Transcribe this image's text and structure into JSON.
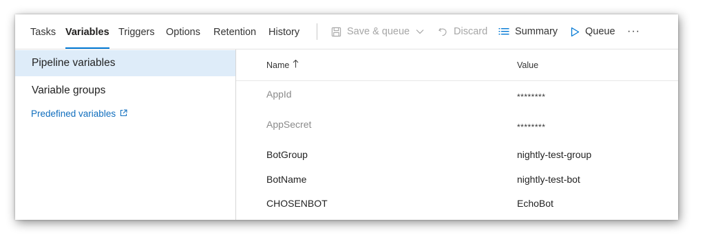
{
  "tabs": [
    {
      "label": "Tasks",
      "active": false
    },
    {
      "label": "Variables",
      "active": true
    },
    {
      "label": "Triggers",
      "active": false
    },
    {
      "label": "Options",
      "active": false
    },
    {
      "label": "Retention",
      "active": false
    },
    {
      "label": "History",
      "active": false
    }
  ],
  "commands": {
    "save_queue": {
      "label": "Save & queue",
      "icon": "save-icon",
      "disabled": true
    },
    "discard": {
      "label": "Discard",
      "icon": "undo-icon",
      "disabled": true
    },
    "summary": {
      "label": "Summary",
      "icon": "list-icon"
    },
    "queue": {
      "label": "Queue",
      "icon": "play-icon"
    },
    "more": {
      "label": "···",
      "icon": "more-icon"
    }
  },
  "sidebar": {
    "items": [
      {
        "label": "Pipeline variables",
        "selected": true
      },
      {
        "label": "Variable groups",
        "selected": false
      }
    ],
    "link": {
      "label": "Predefined variables",
      "icon": "external-link-icon"
    }
  },
  "table": {
    "headers": {
      "name": "Name",
      "value": "Value",
      "sort_icon": "sort-ascending-icon"
    },
    "rows": [
      {
        "name": "AppId",
        "value": "********",
        "secret": true
      },
      {
        "name": "AppSecret",
        "value": "********",
        "secret": true
      },
      {
        "name": "BotGroup",
        "value": "nightly-test-group",
        "secret": false
      },
      {
        "name": "BotName",
        "value": "nightly-test-bot",
        "secret": false
      },
      {
        "name": "CHOSENBOT",
        "value": "EchoBot",
        "secret": false
      }
    ]
  },
  "colors": {
    "accent": "#0078d4",
    "selected_bg": "#deecf9",
    "link": "#106ebe",
    "disabled": "#a6a6a6"
  }
}
